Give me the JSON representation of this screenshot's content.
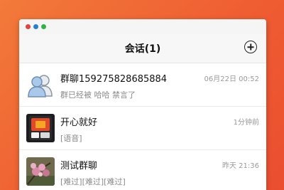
{
  "window": {
    "controls": [
      {
        "name": "close",
        "color": "#e0443e"
      },
      {
        "name": "minimize",
        "color": "#2c7fd0"
      },
      {
        "name": "maximize",
        "color": "#2db34a"
      }
    ]
  },
  "header": {
    "title": "会话(1)",
    "add_icon": "plus-circle-icon"
  },
  "conversations": [
    {
      "name": "群聊159275828685884",
      "preview": "群已经被 哈哈 禁言了",
      "time": "06月22日 00:52",
      "avatar": "group-avatar-icon"
    },
    {
      "name": "开心就好",
      "preview": "[语音]",
      "time": "1分钟前",
      "avatar": "user-photo-avatar"
    },
    {
      "name": "测试群聊",
      "preview": "[难过][难过][难过]",
      "time": "昨天 21:36",
      "avatar": "flower-photo-avatar"
    }
  ]
}
